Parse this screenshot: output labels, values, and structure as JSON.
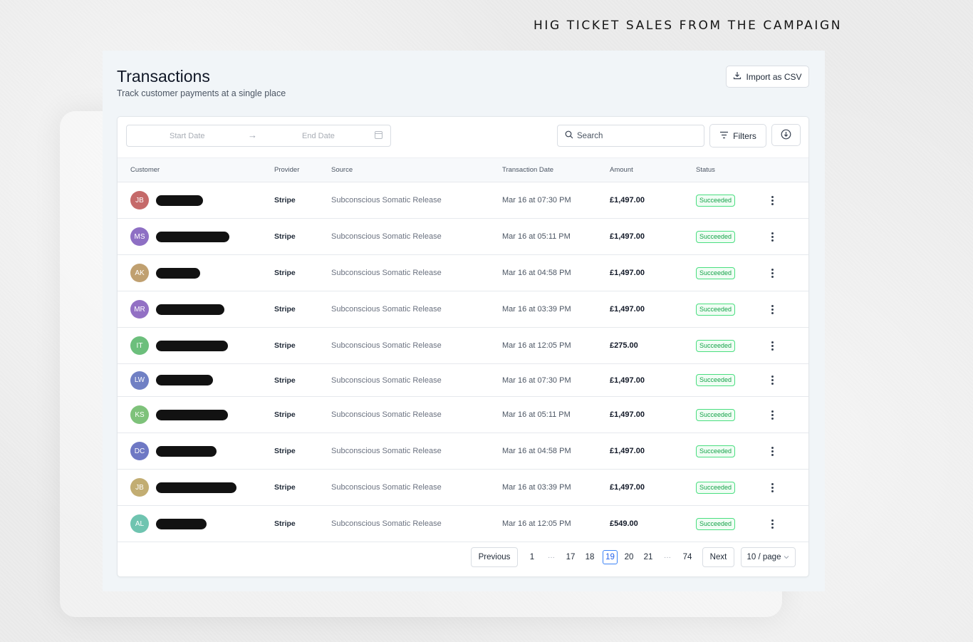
{
  "headline": "HIG TICKET SALES FROM THE CAMPAIGN",
  "page": {
    "title": "Transactions",
    "subtitle": "Track customer payments at a single place",
    "import_label": "Import as CSV"
  },
  "toolbar": {
    "start_date_placeholder": "Start Date",
    "end_date_placeholder": "End Date",
    "search_placeholder": "Search",
    "filters_label": "Filters"
  },
  "columns": [
    "Customer",
    "Provider",
    "Source",
    "Transaction Date",
    "Amount",
    "Status"
  ],
  "rows": [
    {
      "initials": "JB",
      "avatar_color": "#c56a6a",
      "provider": "Stripe",
      "source": "Subconscious Somatic Release",
      "date": "Mar 16 at 07:30 PM",
      "amount": "£1,497.00",
      "status": "Succeeded"
    },
    {
      "initials": "MS",
      "avatar_color": "#8e6fc4",
      "provider": "Stripe",
      "source": "Subconscious Somatic Release",
      "date": "Mar 16 at 05:11 PM",
      "amount": "£1,497.00",
      "status": "Succeeded"
    },
    {
      "initials": "AK",
      "avatar_color": "#c0a070",
      "provider": "Stripe",
      "source": "Subconscious Somatic Release",
      "date": "Mar 16 at 04:58 PM",
      "amount": "£1,497.00",
      "status": "Succeeded"
    },
    {
      "initials": "MR",
      "avatar_color": "#9270c4",
      "provider": "Stripe",
      "source": "Subconscious Somatic Release",
      "date": "Mar 16 at 03:39 PM",
      "amount": "£1,497.00",
      "status": "Succeeded"
    },
    {
      "initials": "IT",
      "avatar_color": "#6cbf7c",
      "provider": "Stripe",
      "source": "Subconscious Somatic Release",
      "date": "Mar 16 at 12:05 PM",
      "amount": "£275.00",
      "status": "Succeeded"
    },
    {
      "initials": "LW",
      "avatar_color": "#7080c4",
      "provider": "Stripe",
      "source": "Subconscious Somatic Release",
      "date": "Mar 16 at 07:30 PM",
      "amount": "£1,497.00",
      "status": "Succeeded"
    },
    {
      "initials": "KS",
      "avatar_color": "#7ec27a",
      "provider": "Stripe",
      "source": "Subconscious Somatic Release",
      "date": "Mar 16 at 05:11 PM",
      "amount": "£1,497.00",
      "status": "Succeeded"
    },
    {
      "initials": "DC",
      "avatar_color": "#6e78c4",
      "provider": "Stripe",
      "source": "Subconscious Somatic Release",
      "date": "Mar 16 at 04:58 PM",
      "amount": "£1,497.00",
      "status": "Succeeded"
    },
    {
      "initials": "JB",
      "avatar_color": "#c2ad72",
      "provider": "Stripe",
      "source": "Subconscious Somatic Release",
      "date": "Mar 16 at 03:39 PM",
      "amount": "£1,497.00",
      "status": "Succeeded"
    },
    {
      "initials": "AL",
      "avatar_color": "#6fc4b0",
      "provider": "Stripe",
      "source": "Subconscious Somatic Release",
      "date": "Mar 16 at 12:05 PM",
      "amount": "£549.00",
      "status": "Succeeded"
    }
  ],
  "pagination": {
    "previous_label": "Previous",
    "next_label": "Next",
    "pages": [
      "1",
      "···",
      "17",
      "18",
      "19",
      "20",
      "21",
      "···",
      "74"
    ],
    "current_page": "19",
    "page_size_label": "10 / page"
  },
  "colors": {
    "accent": "#3b82f6",
    "success": "#16a34a"
  }
}
